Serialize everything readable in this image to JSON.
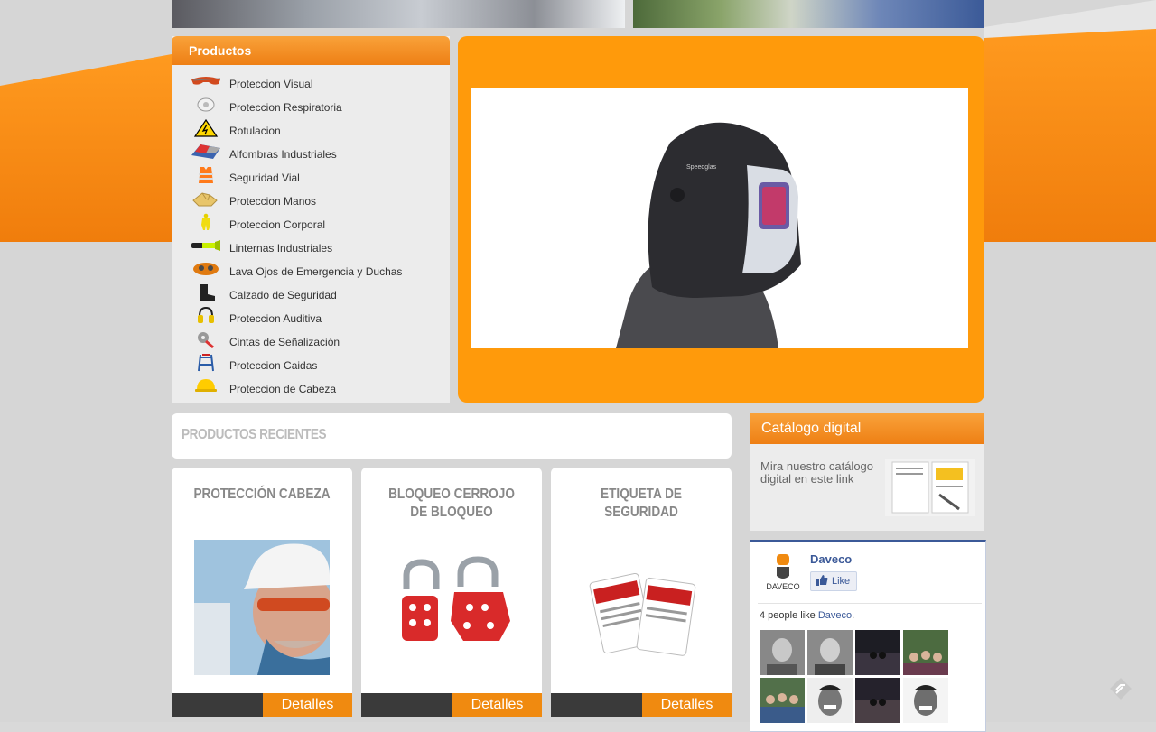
{
  "products_panel": {
    "title": "Productos",
    "items": [
      {
        "label": "Proteccion Visual",
        "icon": "safety-glasses-icon"
      },
      {
        "label": "Proteccion Respiratoria",
        "icon": "respirator-icon"
      },
      {
        "label": "Rotulacion",
        "icon": "warning-sign-icon"
      },
      {
        "label": "Alfombras Industriales",
        "icon": "mat-icon"
      },
      {
        "label": "Seguridad Vial",
        "icon": "traffic-vest-icon"
      },
      {
        "label": "Proteccion Manos",
        "icon": "gloves-icon"
      },
      {
        "label": "Proteccion Corporal",
        "icon": "body-suit-icon"
      },
      {
        "label": "Linternas Industriales",
        "icon": "flashlight-icon"
      },
      {
        "label": "Lava Ojos de Emergencia y Duchas",
        "icon": "eyewash-icon"
      },
      {
        "label": "Calzado de Seguridad",
        "icon": "boot-icon"
      },
      {
        "label": "Proteccion Auditiva",
        "icon": "earmuffs-icon"
      },
      {
        "label": "Cintas de Señalización",
        "icon": "tape-icon"
      },
      {
        "label": "Proteccion Caidas",
        "icon": "harness-icon"
      },
      {
        "label": "Proteccion de Cabeza",
        "icon": "hardhat-icon"
      }
    ]
  },
  "hero": {
    "image": "welding-helmet-image",
    "brand_text": "Speedglas"
  },
  "recent": {
    "title": "PRODUCTOS RECIENTES",
    "cards": [
      {
        "title": "PROTECCIÓN CABEZA",
        "button": "Detalles",
        "image": "worker-hardhat-image"
      },
      {
        "title": "BLOQUEO CERROJO DE BLOQUEO",
        "button": "Detalles",
        "image": "lockout-hasp-image"
      },
      {
        "title": "ETIQUETA DE SEGURIDAD",
        "button": "Detalles",
        "image": "danger-tag-image"
      }
    ]
  },
  "catalog": {
    "title": "Catálogo digital",
    "text": "Mira nuestro catálogo digital en este link",
    "image": "catalog-thumbnail-image"
  },
  "facebook": {
    "page_name": "Daveco",
    "logo_text": "DAVECO",
    "like_label": "Like",
    "count_prefix": "4 people like ",
    "count_link": "Daveco",
    "count_suffix": ".",
    "colors": {
      "link": "#3b5998"
    }
  },
  "colors": {
    "accent": "#f08a10",
    "hero_bg": "#ff9a0b",
    "panel_bg": "#ececec"
  }
}
